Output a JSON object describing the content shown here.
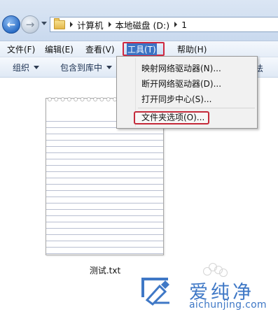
{
  "address": {
    "crumbs": [
      "计算机",
      "本地磁盘 (D:)",
      "1"
    ]
  },
  "menubar": {
    "items": [
      "文件(F)",
      "编辑(E)",
      "查看(V)",
      "工具(T)",
      "帮助(H)"
    ],
    "active_index": 3
  },
  "commandbar": {
    "organize": "组织",
    "include_in_library": "包含到库中",
    "partial_more": "法"
  },
  "tools_menu": {
    "items": [
      "映射网络驱动器(N)...",
      "断开网络驱动器(D)...",
      "打开同步中心(S)..."
    ],
    "folder_options": "文件夹选项(O)..."
  },
  "file": {
    "name": "测试.txt"
  },
  "watermark": {
    "name": "爱纯净",
    "url": "aichunjing.com"
  },
  "colors": {
    "highlight_border": "#d0283f",
    "selection_blue": "#3b73c4",
    "watermark_blue": "#3f78c6"
  }
}
